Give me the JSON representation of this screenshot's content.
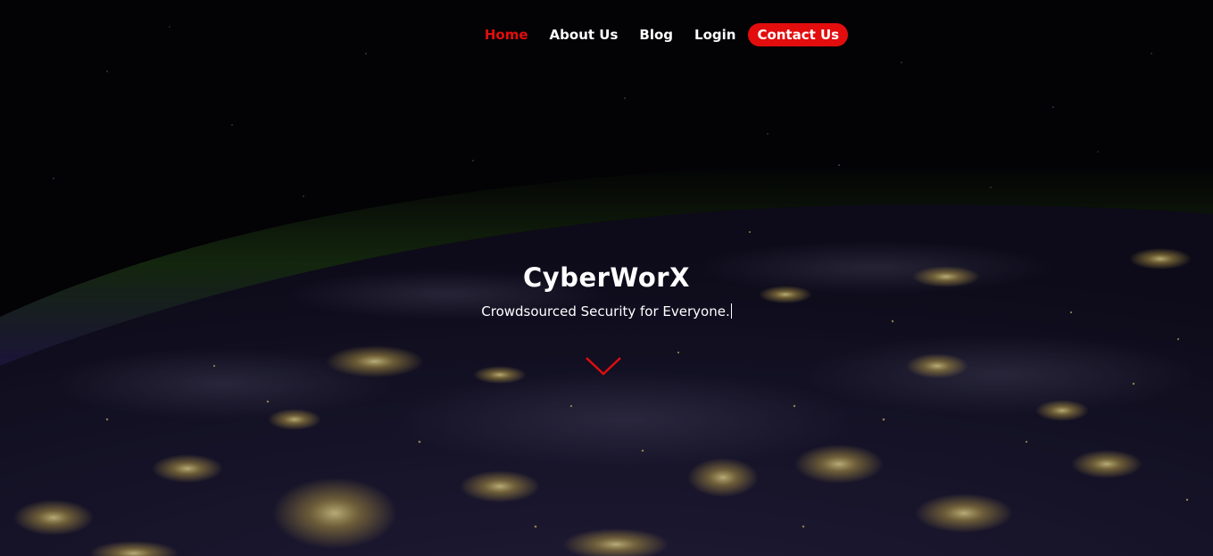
{
  "nav": {
    "items": [
      {
        "label": "Home",
        "active": true
      },
      {
        "label": "About Us",
        "active": false
      },
      {
        "label": "Blog",
        "active": false
      },
      {
        "label": "Login",
        "active": false
      }
    ],
    "contact_label": "Contact Us"
  },
  "hero": {
    "title": "CyberWorX",
    "subtitle": "Crowdsourced Security for Everyone."
  },
  "icons": {
    "scroll": "chevron-down-icon"
  },
  "colors": {
    "accent": "#e30d0d",
    "text": "#ffffff",
    "background": "#040307",
    "city_lights": "#f2d36b",
    "atmosphere": "#2f5a1c",
    "planet": "#1c1838"
  }
}
